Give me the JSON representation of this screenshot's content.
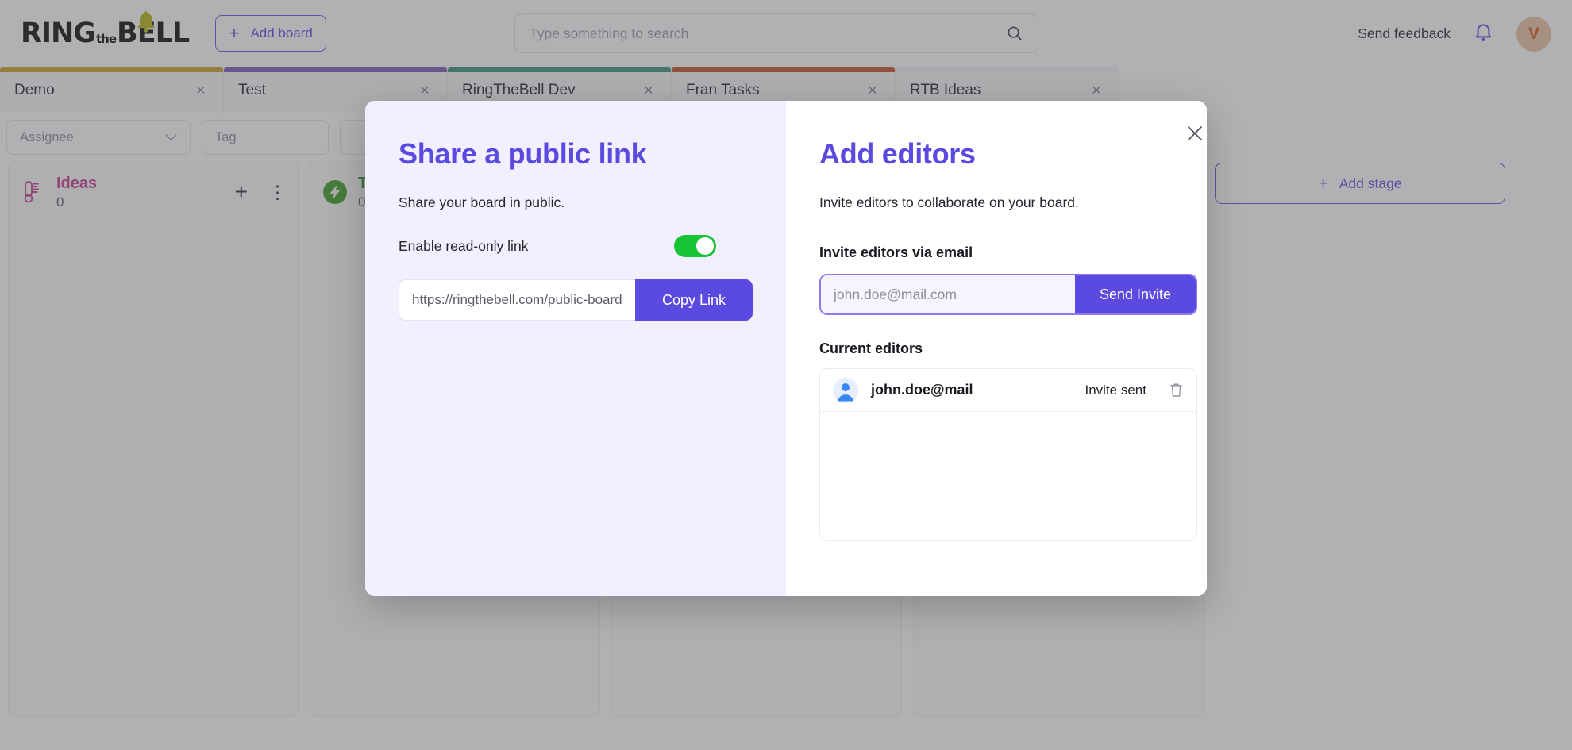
{
  "colors": {
    "accent_purple": "#5b4ae0",
    "toggle_green": "#16c436",
    "ideas_pink": "#c43b8e",
    "tab_demo": "#c9a227",
    "tab_test": "#7a5bb5",
    "tab_dev": "#3a8f7a",
    "tab_fran": "#c0502a"
  },
  "topbar": {
    "logo_ring": "RING",
    "logo_the": "the",
    "logo_bell": "BELL",
    "add_board_label": "Add board",
    "add_board_plus": "+",
    "search_placeholder": "Type something to search",
    "search_value": "",
    "send_feedback_label": "Send feedback"
  },
  "avatar": {
    "initial": "V"
  },
  "tabs": [
    {
      "label": "Demo",
      "accent": "#c9a227",
      "close": "×"
    },
    {
      "label": "Test",
      "accent": "#7a5bb5",
      "close": "×"
    },
    {
      "label": "RingTheBell Dev",
      "accent": "#3a8f7a",
      "close": "×"
    },
    {
      "label": "Fran Tasks",
      "accent": "#c0502a",
      "close": "×"
    },
    {
      "label": "RTB Ideas",
      "accent": "#f2f2f5",
      "close": "×"
    }
  ],
  "filters": {
    "assignee_label": "Assignee",
    "assignee_chevron": "▼",
    "tag_placeholder": "Tag",
    "tag_value": ""
  },
  "board": {
    "add_stage_label": "Add stage",
    "add_stage_plus": "+",
    "stages": [
      {
        "title": "Ideas",
        "count": "0",
        "color": "#c43b8e",
        "icon": "thermometer-icon",
        "add": "+",
        "menu": "⋮"
      },
      {
        "title": "T",
        "count": "0",
        "color": "#2e8b2e",
        "icon": "lightning-badge-icon",
        "add": "+",
        "menu": "⋮"
      }
    ]
  },
  "modal": {
    "close_label": "×",
    "share": {
      "title": "Share a public link",
      "description": "Share your board in public.",
      "toggle_label": "Enable read-only link",
      "toggle_on": "on",
      "link_value": "https://ringthebell.com/public-board/a",
      "copy_label": "Copy Link"
    },
    "editors": {
      "title": "Add editors",
      "description": "Invite editors to collaborate on your board.",
      "invite_field_label": "Invite editors via email",
      "invite_placeholder": "john.doe@mail.com",
      "invite_value": "",
      "send_invite_label": "Send Invite",
      "current_editors_label": "Current editors",
      "rows": [
        {
          "email": "john.doe@mail",
          "status": "Invite sent"
        }
      ]
    }
  }
}
